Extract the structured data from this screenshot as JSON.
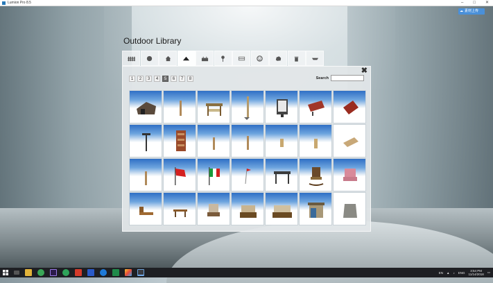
{
  "window": {
    "title": "Lumion Pro 8.5"
  },
  "upload_button": {
    "label": "素材上传"
  },
  "library": {
    "title": "Outdoor Library",
    "tabs": [
      {
        "name": "tab-fence",
        "icon": "fence-icon",
        "active": false
      },
      {
        "name": "tab-sphere",
        "icon": "sphere-icon",
        "active": false
      },
      {
        "name": "tab-house",
        "icon": "house-icon",
        "active": false
      },
      {
        "name": "tab-terrain",
        "icon": "mountain-icon",
        "active": true
      },
      {
        "name": "tab-building",
        "icon": "building-icon",
        "active": false
      },
      {
        "name": "tab-lamp",
        "icon": "street-lamp-icon",
        "active": false
      },
      {
        "name": "tab-bench",
        "icon": "bench-icon",
        "active": false
      },
      {
        "name": "tab-playground",
        "icon": "playground-icon",
        "active": false
      },
      {
        "name": "tab-rock",
        "icon": "rock-icon",
        "active": false
      },
      {
        "name": "tab-trash",
        "icon": "trash-bin-icon",
        "active": false
      },
      {
        "name": "tab-boat",
        "icon": "boat-icon",
        "active": false
      }
    ],
    "pages": [
      "1",
      "2",
      "3",
      "4",
      "5",
      "6",
      "7",
      "8"
    ],
    "active_page": "5",
    "search_label": "Search",
    "search_value": ""
  },
  "taskbar": {
    "apps": [
      "file-explorer-icon",
      "chrome-icon",
      "premiere-icon",
      "app-green-icon",
      "app-red-icon",
      "app-blue-icon",
      "edge-icon",
      "excel-icon",
      "photos-icon",
      "lumion-icon"
    ],
    "tray_text": "EN",
    "lang": "ENG",
    "time": "3:54 PM",
    "date": "11/14/2018"
  }
}
